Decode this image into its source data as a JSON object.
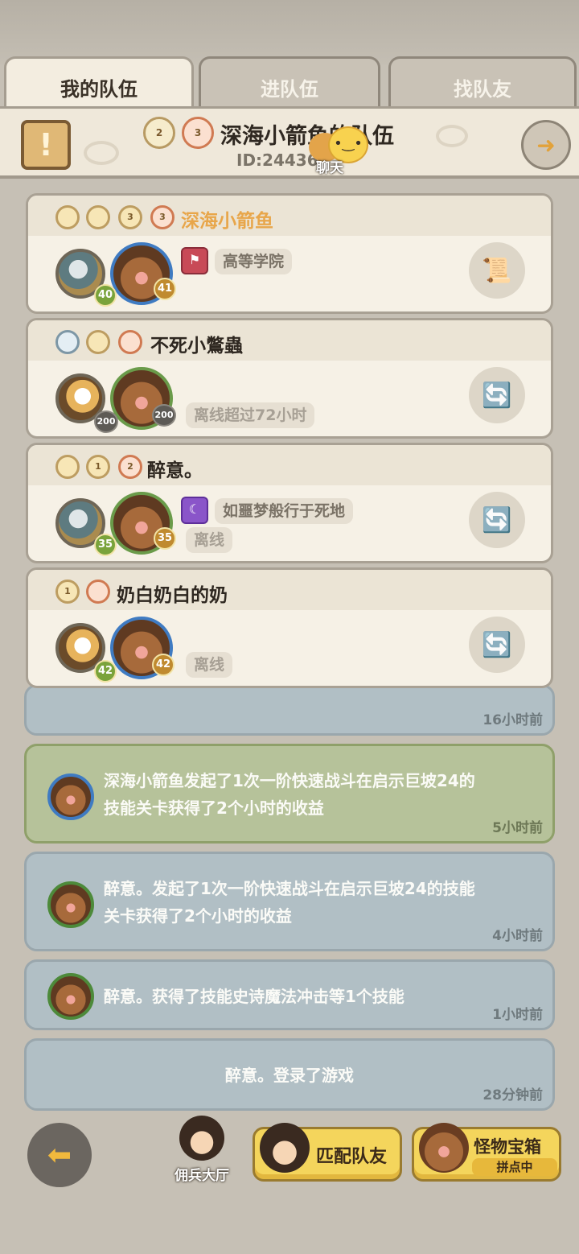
{
  "tabs": [
    "我的队伍",
    "进队伍",
    "找队友"
  ],
  "header": {
    "team_name": "深海小箭鱼的队伍",
    "team_id": "ID:244366",
    "chat_label": "聊天",
    "badges": [
      "2",
      "3"
    ]
  },
  "members": [
    {
      "name": "深海小箭鱼",
      "badges": [
        "",
        "",
        "3",
        "3"
      ],
      "levels": [
        "40",
        "41"
      ],
      "guild": "高等学院",
      "status": ""
    },
    {
      "name": "不死小鷩蟲",
      "badges": [
        "",
        "",
        ""
      ],
      "levels": [
        "200",
        "200"
      ],
      "guild": "",
      "status": "离线超过72小时"
    },
    {
      "name": "醉意。",
      "badges": [
        "",
        "1",
        "2"
      ],
      "levels": [
        "35",
        "35"
      ],
      "guild": "如噩梦般行于死地",
      "status": "离线"
    },
    {
      "name": "奶白奶白的奶",
      "badges": [
        "1",
        ""
      ],
      "levels": [
        "42",
        "42"
      ],
      "guild": "",
      "status": "离线"
    }
  ],
  "feed": [
    {
      "time": "16小时前"
    },
    {
      "line1": "深海小箭鱼发起了1次一阶快速战斗在启示巨坡24的",
      "line2": "技能关卡获得了2个小时的收益",
      "time": "5小时前"
    },
    {
      "line1": "醉意。发起了1次一阶快速战斗在启示巨坡24的技能",
      "line2": "关卡获得了2个小时的收益",
      "time": "4小时前"
    },
    {
      "line1": "醉意。获得了技能史诗魔法冲击等1个技能",
      "time": "1小时前"
    },
    {
      "line1": "醉意。登录了游戏",
      "time": "28分钟前"
    }
  ],
  "bottom": {
    "mercenary_hall": "佣兵大厅",
    "match_button": "匹配队友",
    "chest_title": "怪物宝箱",
    "chest_sub": "拼点中"
  },
  "colors": {
    "leader_name": "#e8a64a",
    "feed_green": "#b6c29a",
    "feed_blue": "#b1bfc5",
    "button_yellow": "#f4d55c"
  }
}
